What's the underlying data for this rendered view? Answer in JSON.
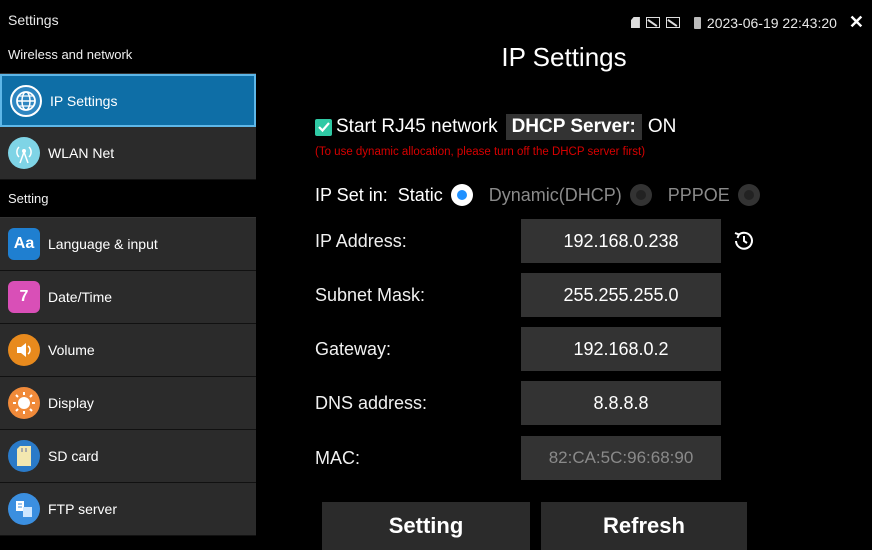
{
  "status": {
    "app_title": "Settings",
    "datetime": "2023-06-19 22:43:20",
    "close_glyph": "✕"
  },
  "sidebar": {
    "section_wireless": "Wireless and network",
    "section_setting": "Setting",
    "items": [
      {
        "label": "IP Settings",
        "icon": "globe-icon",
        "active": true
      },
      {
        "label": "WLAN Net",
        "icon": "wifi-antenna-icon"
      },
      {
        "label": "Language & input",
        "icon": "language-icon",
        "glyph": "Aa"
      },
      {
        "label": "Date/Time",
        "icon": "calendar-icon",
        "glyph": "7"
      },
      {
        "label": "Volume",
        "icon": "volume-icon"
      },
      {
        "label": "Display",
        "icon": "brightness-icon"
      },
      {
        "label": "SD card",
        "icon": "sd-card-icon"
      },
      {
        "label": "FTP server",
        "icon": "ftp-icon"
      }
    ]
  },
  "main": {
    "title": "IP Settings",
    "start_rj45_label": "Start RJ45 network",
    "start_rj45_checked": true,
    "dhcp_server_label": "DHCP Server:",
    "dhcp_server_state": "ON",
    "warning": "(To use dynamic allocation, please turn off the DHCP server first)",
    "ip_set_label": "IP Set in:",
    "ip_modes": [
      {
        "label": "Static",
        "selected": true
      },
      {
        "label": "Dynamic(DHCP)",
        "selected": false
      },
      {
        "label": "PPPOE",
        "selected": false
      }
    ],
    "fields": {
      "ip_address": {
        "label": "IP Address:",
        "value": "192.168.0.238"
      },
      "subnet_mask": {
        "label": "Subnet Mask:",
        "value": "255.255.255.0"
      },
      "gateway": {
        "label": "Gateway:",
        "value": "192.168.0.2"
      },
      "dns": {
        "label": "DNS address:",
        "value": "8.8.8.8"
      },
      "mac": {
        "label": "MAC:",
        "value": "82:CA:5C:96:68:90"
      }
    },
    "setting_button": "Setting",
    "refresh_button": "Refresh"
  },
  "colors": {
    "active_item": "#0e6ea6",
    "checkbox": "#2fc9a4",
    "warning": "#d80000",
    "radio_selected": "#1e90ff"
  }
}
